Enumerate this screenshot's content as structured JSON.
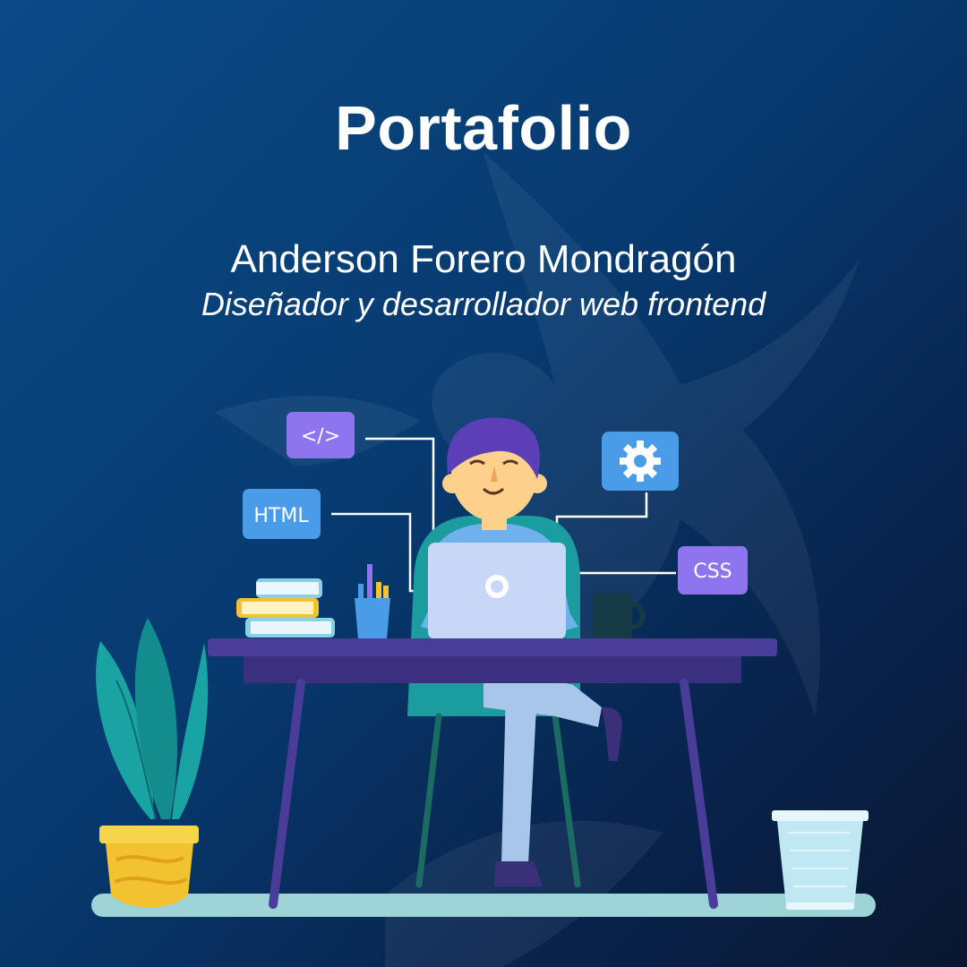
{
  "poster": {
    "title": "Portafolio",
    "name": "Anderson Forero Mondragón",
    "role": "Diseñador y desarrollador web frontend"
  },
  "tags": {
    "code": "</>",
    "html": "HTML",
    "css": "CSS"
  },
  "colors": {
    "background_start": "#0b4a86",
    "background_end": "#0a1630",
    "tag_purple": "#8f74f0",
    "tag_blue": "#4a9be8",
    "desk": "#4a3d9a",
    "plant_pot": "#f2c230",
    "floor": "#9ed3d8"
  },
  "icons": [
    "code-icon",
    "gear-icon",
    "laptop-logo-icon"
  ]
}
